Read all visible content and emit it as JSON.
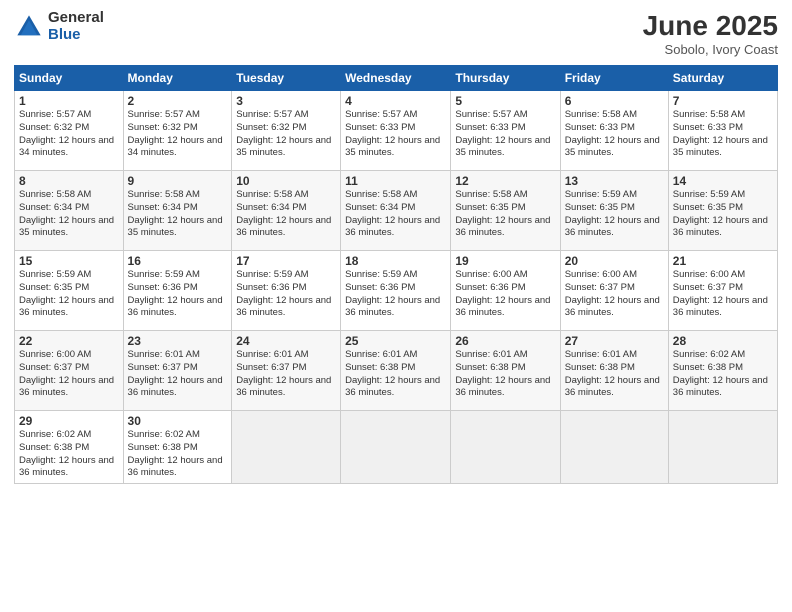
{
  "header": {
    "logo_general": "General",
    "logo_blue": "Blue",
    "month_year": "June 2025",
    "location": "Sobolo, Ivory Coast"
  },
  "weekdays": [
    "Sunday",
    "Monday",
    "Tuesday",
    "Wednesday",
    "Thursday",
    "Friday",
    "Saturday"
  ],
  "weeks": [
    [
      {
        "day": "1",
        "sunrise": "5:57 AM",
        "sunset": "6:32 PM",
        "daylight": "12 hours and 34 minutes."
      },
      {
        "day": "2",
        "sunrise": "5:57 AM",
        "sunset": "6:32 PM",
        "daylight": "12 hours and 34 minutes."
      },
      {
        "day": "3",
        "sunrise": "5:57 AM",
        "sunset": "6:32 PM",
        "daylight": "12 hours and 35 minutes."
      },
      {
        "day": "4",
        "sunrise": "5:57 AM",
        "sunset": "6:33 PM",
        "daylight": "12 hours and 35 minutes."
      },
      {
        "day": "5",
        "sunrise": "5:57 AM",
        "sunset": "6:33 PM",
        "daylight": "12 hours and 35 minutes."
      },
      {
        "day": "6",
        "sunrise": "5:58 AM",
        "sunset": "6:33 PM",
        "daylight": "12 hours and 35 minutes."
      },
      {
        "day": "7",
        "sunrise": "5:58 AM",
        "sunset": "6:33 PM",
        "daylight": "12 hours and 35 minutes."
      }
    ],
    [
      {
        "day": "8",
        "sunrise": "5:58 AM",
        "sunset": "6:34 PM",
        "daylight": "12 hours and 35 minutes."
      },
      {
        "day": "9",
        "sunrise": "5:58 AM",
        "sunset": "6:34 PM",
        "daylight": "12 hours and 35 minutes."
      },
      {
        "day": "10",
        "sunrise": "5:58 AM",
        "sunset": "6:34 PM",
        "daylight": "12 hours and 36 minutes."
      },
      {
        "day": "11",
        "sunrise": "5:58 AM",
        "sunset": "6:34 PM",
        "daylight": "12 hours and 36 minutes."
      },
      {
        "day": "12",
        "sunrise": "5:58 AM",
        "sunset": "6:35 PM",
        "daylight": "12 hours and 36 minutes."
      },
      {
        "day": "13",
        "sunrise": "5:59 AM",
        "sunset": "6:35 PM",
        "daylight": "12 hours and 36 minutes."
      },
      {
        "day": "14",
        "sunrise": "5:59 AM",
        "sunset": "6:35 PM",
        "daylight": "12 hours and 36 minutes."
      }
    ],
    [
      {
        "day": "15",
        "sunrise": "5:59 AM",
        "sunset": "6:35 PM",
        "daylight": "12 hours and 36 minutes."
      },
      {
        "day": "16",
        "sunrise": "5:59 AM",
        "sunset": "6:36 PM",
        "daylight": "12 hours and 36 minutes."
      },
      {
        "day": "17",
        "sunrise": "5:59 AM",
        "sunset": "6:36 PM",
        "daylight": "12 hours and 36 minutes."
      },
      {
        "day": "18",
        "sunrise": "5:59 AM",
        "sunset": "6:36 PM",
        "daylight": "12 hours and 36 minutes."
      },
      {
        "day": "19",
        "sunrise": "6:00 AM",
        "sunset": "6:36 PM",
        "daylight": "12 hours and 36 minutes."
      },
      {
        "day": "20",
        "sunrise": "6:00 AM",
        "sunset": "6:37 PM",
        "daylight": "12 hours and 36 minutes."
      },
      {
        "day": "21",
        "sunrise": "6:00 AM",
        "sunset": "6:37 PM",
        "daylight": "12 hours and 36 minutes."
      }
    ],
    [
      {
        "day": "22",
        "sunrise": "6:00 AM",
        "sunset": "6:37 PM",
        "daylight": "12 hours and 36 minutes."
      },
      {
        "day": "23",
        "sunrise": "6:01 AM",
        "sunset": "6:37 PM",
        "daylight": "12 hours and 36 minutes."
      },
      {
        "day": "24",
        "sunrise": "6:01 AM",
        "sunset": "6:37 PM",
        "daylight": "12 hours and 36 minutes."
      },
      {
        "day": "25",
        "sunrise": "6:01 AM",
        "sunset": "6:38 PM",
        "daylight": "12 hours and 36 minutes."
      },
      {
        "day": "26",
        "sunrise": "6:01 AM",
        "sunset": "6:38 PM",
        "daylight": "12 hours and 36 minutes."
      },
      {
        "day": "27",
        "sunrise": "6:01 AM",
        "sunset": "6:38 PM",
        "daylight": "12 hours and 36 minutes."
      },
      {
        "day": "28",
        "sunrise": "6:02 AM",
        "sunset": "6:38 PM",
        "daylight": "12 hours and 36 minutes."
      }
    ],
    [
      {
        "day": "29",
        "sunrise": "6:02 AM",
        "sunset": "6:38 PM",
        "daylight": "12 hours and 36 minutes."
      },
      {
        "day": "30",
        "sunrise": "6:02 AM",
        "sunset": "6:38 PM",
        "daylight": "12 hours and 36 minutes."
      },
      null,
      null,
      null,
      null,
      null
    ]
  ]
}
